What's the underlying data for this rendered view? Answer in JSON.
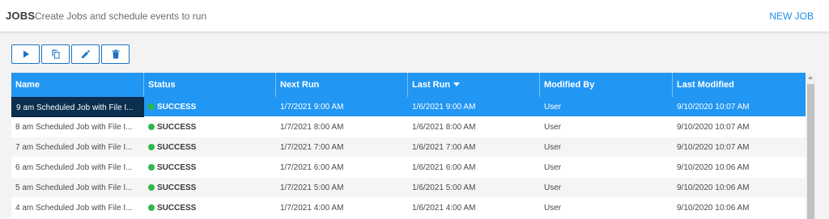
{
  "header": {
    "title": "JOBS",
    "subtitle": "Create Jobs and schedule events to run",
    "new_job_label": "NEW JOB"
  },
  "toolbar": {
    "buttons": [
      {
        "icon": "play-icon"
      },
      {
        "icon": "copy-icon"
      },
      {
        "icon": "edit-icon"
      },
      {
        "icon": "delete-icon"
      }
    ]
  },
  "table": {
    "columns": [
      "Name",
      "Status",
      "Next Run",
      "Last Run",
      "Modified By",
      "Last Modified"
    ],
    "sorted_column": "Last Run",
    "sort_direction": "descending",
    "rows": [
      {
        "name": "9 am Scheduled Job with File I...",
        "status": "SUCCESS",
        "next_run": "1/7/2021 9:00 AM",
        "last_run": "1/6/2021 9:00 AM",
        "modified_by": "User",
        "last_modified": "9/10/2020 10:07 AM"
      },
      {
        "name": "8 am Scheduled Job with File I...",
        "status": "SUCCESS",
        "next_run": "1/7/2021 8:00 AM",
        "last_run": "1/6/2021 8:00 AM",
        "modified_by": "User",
        "last_modified": "9/10/2020 10:07 AM"
      },
      {
        "name": "7 am Scheduled Job with File I...",
        "status": "SUCCESS",
        "next_run": "1/7/2021 7:00 AM",
        "last_run": "1/6/2021 7:00 AM",
        "modified_by": "User",
        "last_modified": "9/10/2020 10:07 AM"
      },
      {
        "name": "6 am Scheduled Job with File I...",
        "status": "SUCCESS",
        "next_run": "1/7/2021 6:00 AM",
        "last_run": "1/6/2021 6:00 AM",
        "modified_by": "User",
        "last_modified": "9/10/2020 10:06 AM"
      },
      {
        "name": "5 am Scheduled Job with File I...",
        "status": "SUCCESS",
        "next_run": "1/7/2021 5:00 AM",
        "last_run": "1/6/2021 5:00 AM",
        "modified_by": "User",
        "last_modified": "9/10/2020 10:06 AM"
      },
      {
        "name": "4 am Scheduled Job with File I...",
        "status": "SUCCESS",
        "next_run": "1/7/2021 4:00 AM",
        "last_run": "1/6/2021 4:00 AM",
        "modified_by": "User",
        "last_modified": "9/10/2020 10:06 AM"
      }
    ],
    "selected_row": 0
  },
  "colors": {
    "accent": "#2196f3",
    "selected_name_bg": "#0b2f4f",
    "success": "#2fb84a",
    "link": "#1f8ee6"
  }
}
